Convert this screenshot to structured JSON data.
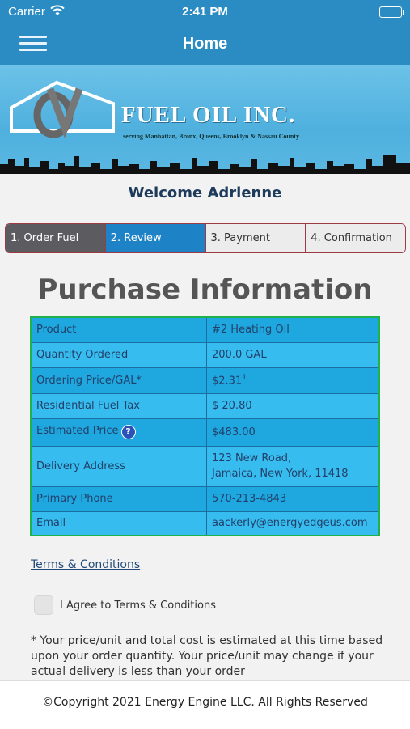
{
  "status_bar": {
    "carrier": "Carrier",
    "time": "2:41 PM"
  },
  "navbar": {
    "title": "Home"
  },
  "banner": {
    "company": "FUEL OIL INC.",
    "tagline": "serving Manhattan, Bronx, Queens, Brooklyn & Nassau County"
  },
  "welcome": "Welcome Adrienne",
  "steps": [
    "1. Order Fuel",
    "2. Review",
    "3. Payment",
    "4. Confirmation"
  ],
  "heading": "Purchase Information",
  "purchase": {
    "product": {
      "label": "Product",
      "value": "#2 Heating Oil"
    },
    "quantity": {
      "label": "Quantity Ordered",
      "value": "200.0 GAL"
    },
    "price": {
      "label": "Ordering Price/GAL*",
      "value": "$2.31",
      "sup": "1"
    },
    "tax": {
      "label": "Residential Fuel Tax",
      "value": "$ 20.80"
    },
    "estimate": {
      "label": "Estimated Price",
      "value": "$483.00"
    },
    "address": {
      "label": "Delivery Address",
      "line1": "123 New Road,",
      "line2": "Jamaica, New York, 11418"
    },
    "phone": {
      "label": "Primary Phone",
      "value": "570-213-4843"
    },
    "email": {
      "label": "Email",
      "value": "aackerly@energyedgeus.com"
    }
  },
  "terms_link": "Terms & Conditions",
  "agree_label": "I Agree to Terms & Conditions",
  "disclaimer": "* Your price/unit and total cost is estimated at this time based upon your order quantity. Your price/unit may change if your actual delivery is less than your order",
  "footer": "©Copyright 2021 Energy Engine LLC. All Rights Reserved",
  "colors": {
    "primary": "#2b8cc4",
    "step_active": "#1e82c6",
    "table_cell": "#1fa7df",
    "table_border": "#1fb24a"
  }
}
